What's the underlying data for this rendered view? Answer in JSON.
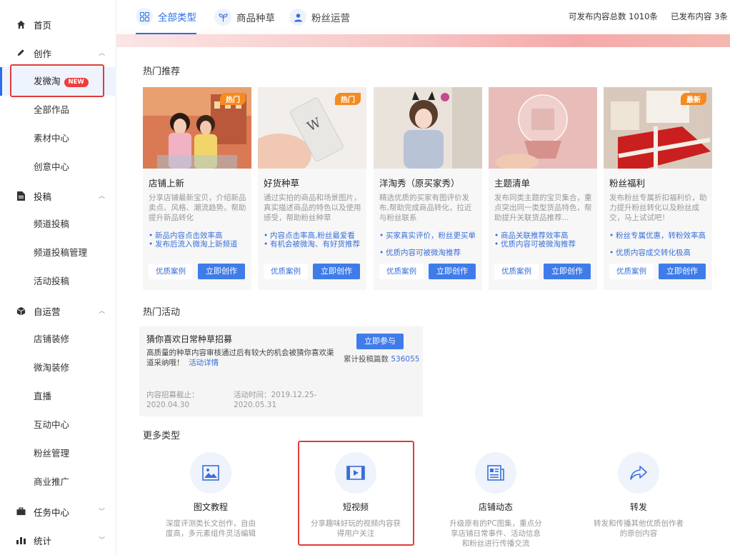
{
  "sidebar": {
    "groups": [
      {
        "label": "首页",
        "icon": "home-icon"
      },
      {
        "label": "创作",
        "icon": "pen-icon"
      },
      {
        "label": "投稿",
        "icon": "document-icon"
      },
      {
        "label": "自运营",
        "icon": "box-icon"
      },
      {
        "label": "任务中心",
        "icon": "briefcase-icon"
      },
      {
        "label": "统计",
        "icon": "bar-chart-icon"
      }
    ],
    "create_items": [
      "发微淘",
      "全部作品",
      "素材中心",
      "创意中心"
    ],
    "new_badge": "NEW",
    "submit_items": [
      "频道投稿",
      "频道投稿管理",
      "活动投稿"
    ],
    "self_items": [
      "店铺装修",
      "微淘装修",
      "直播",
      "互动中心",
      "粉丝管理",
      "商业推广"
    ]
  },
  "header": {
    "tabs": [
      {
        "label": "全部类型",
        "icon": "grid-icon"
      },
      {
        "label": "商品种草",
        "icon": "sprout-icon"
      },
      {
        "label": "粉丝运营",
        "icon": "user-icon"
      }
    ],
    "total_label": "可发布内容总数",
    "total_value": "1010条",
    "published_label": "已发布内容",
    "published_value": "3条"
  },
  "hot": {
    "title": "热门推荐",
    "case_label": "优质案例",
    "create_label": "立即创作",
    "cards": [
      {
        "tag": "热门",
        "title": "店铺上新",
        "desc": "分享店铺最新宝贝，介绍新品卖点、风格、潮流趋势。帮助提升新品转化",
        "bullets": [
          "新品内容点击效率高",
          "发布后流入微淘上新频道"
        ]
      },
      {
        "tag": "热门",
        "title": "好货种草",
        "desc": "通过实拍的商品和场景图片，真实描述商品的特色以及使用感受，帮助粉丝种草",
        "bullets": [
          "内容点击率高,粉丝最爱看",
          "有机会被微淘、有好货推荐"
        ]
      },
      {
        "tag": "",
        "title": "洋淘秀（原买家秀）",
        "desc": "精选优质的买家有图评价发布,帮助完成商品转化，拉近与粉丝联系",
        "bullets": [
          "买家真实评价，粉丝更买单",
          "优质内容可被微淘推荐"
        ]
      },
      {
        "tag": "",
        "title": "主题清单",
        "desc": "发布同类主题的宝贝集合，重点突出同一类型货品特色，帮助提升关联货品推荐...",
        "bullets": [
          "商品关联推荐效率高",
          "优质内容可被微淘推荐"
        ]
      },
      {
        "tag": "最新",
        "title": "粉丝福利",
        "desc": "发布粉丝专属折扣福利价，助力提升粉丝转化以及粉丝成交，马上试试吧！",
        "bullets": [
          "粉丝专属优惠，转粉效率高",
          "优质内容成交转化极高"
        ]
      }
    ]
  },
  "activity": {
    "section_title": "热门活动",
    "title": "猜你喜欢日常种草招募",
    "desc": "高质量的种草内容审核通过后有较大的机会被猜你喜欢渠道采纳哦！",
    "detail_link": "活动详情",
    "join_label": "立即参与",
    "count_label": "累计投稿篇数",
    "count_value": "536055",
    "deadline_label": "内容招募截止：",
    "deadline_value": "2020.04.30",
    "period_label": "活动时间：2019.12.25-",
    "period_end": "2020.05.31"
  },
  "more": {
    "title": "更多类型",
    "types": [
      {
        "name": "图文教程",
        "icon": "image-icon",
        "desc_lines": [
          "深度评测类长文创作，自由",
          "度高，多元素组件灵活编辑"
        ]
      },
      {
        "name": "短视频",
        "icon": "video-icon",
        "desc_lines": [
          "分享趣味好玩的视频内容获",
          "得用户关注"
        ]
      },
      {
        "name": "店铺动态",
        "icon": "newspaper-icon",
        "desc_lines": [
          "升级原有的PC图集，重点分",
          "享店铺日常事件、活动信息",
          "和粉丝进行传播交流"
        ]
      },
      {
        "name": "转发",
        "icon": "share-icon",
        "desc_lines": [
          "转发和传播其他优质创作者",
          "的原创内容"
        ]
      }
    ]
  },
  "colors": {
    "accent": "#2b6ee8",
    "highlight": "#e03c3c",
    "hot_tag": "#f58a1f"
  }
}
